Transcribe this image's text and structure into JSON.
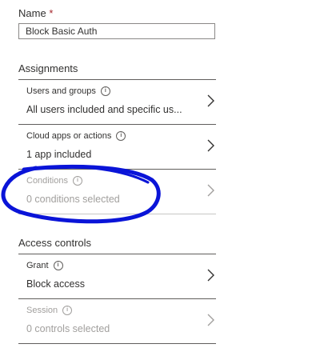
{
  "name_field": {
    "label": "Name",
    "required_mark": "*",
    "value": "Block Basic Auth"
  },
  "assignments": {
    "title": "Assignments",
    "items": [
      {
        "label": "Users and groups",
        "value": "All users included and specific us...",
        "enabled": true,
        "icon": "info-icon"
      },
      {
        "label": "Cloud apps or actions",
        "value": "1 app included",
        "enabled": true,
        "icon": "info-icon"
      },
      {
        "label": "Conditions",
        "value": "0 conditions selected",
        "enabled": false,
        "icon": "info-icon"
      }
    ]
  },
  "access_controls": {
    "title": "Access controls",
    "items": [
      {
        "label": "Grant",
        "value": "Block access",
        "enabled": true,
        "icon": "info-icon"
      },
      {
        "label": "Session",
        "value": "0 controls selected",
        "enabled": false,
        "icon": "info-icon"
      }
    ]
  },
  "annotation": {
    "color": "#0a14d8"
  },
  "colors": {
    "text": "#323130",
    "disabled": "#a19f9d",
    "required": "#a4262c",
    "divider": "#605e5c"
  }
}
